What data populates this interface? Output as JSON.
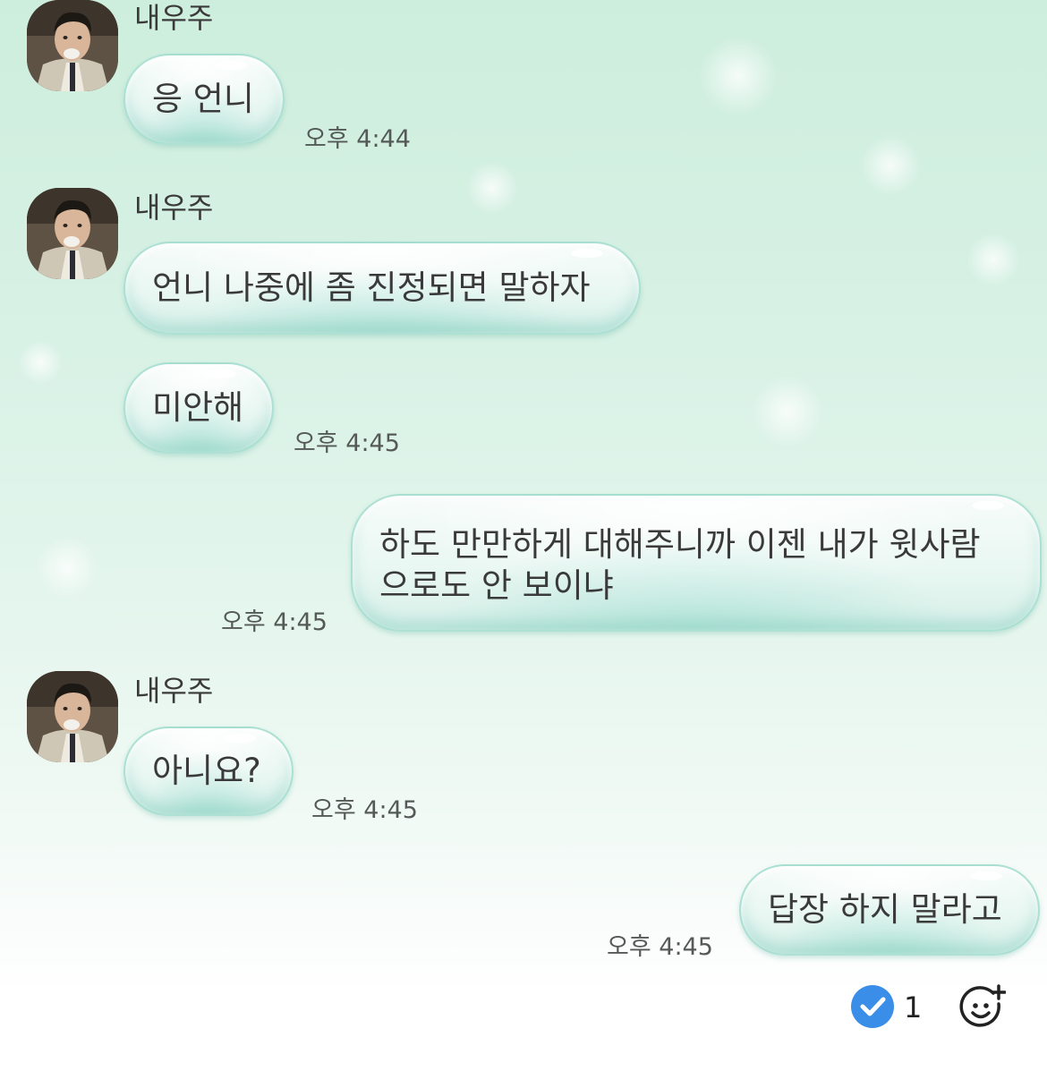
{
  "sender_name": "내우주",
  "messages": [
    {
      "from": "other",
      "show_name": true,
      "text": "응 언니",
      "time": "오후 4:44"
    },
    {
      "from": "other",
      "show_name": true,
      "text": "언니 나중에 좀 진정되면 말하자",
      "time": ""
    },
    {
      "from": "other",
      "show_name": false,
      "text": "미안해",
      "time": "오후 4:45"
    },
    {
      "from": "me",
      "text_line1": "하도 만만하게 대해주니까 이젠 내가 윗사람",
      "text_line2": "으로도 안 보이냐",
      "time": "오후 4:45"
    },
    {
      "from": "other",
      "show_name": true,
      "text": "아니요?",
      "time": "오후 4:45"
    },
    {
      "from": "me",
      "text": "답장 하지 말라고",
      "time": "오후 4:45"
    }
  ],
  "footer": {
    "read_count": "1",
    "read_icon": "check-circle-icon",
    "reaction_icon": "add-reaction-icon"
  },
  "colors": {
    "bubble_border": "#a0dccd",
    "read_badge": "#3b8ee8",
    "text": "#3a3a3a",
    "time": "#555a58"
  }
}
